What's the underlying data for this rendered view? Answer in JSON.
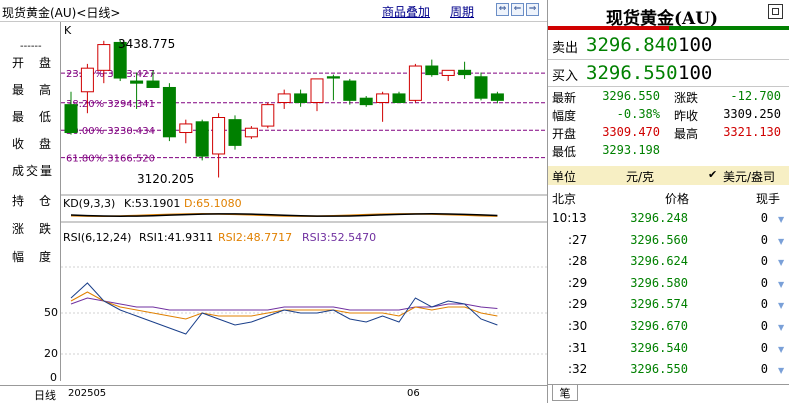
{
  "topbar": {
    "title": "现货黄金(AU)<日线>",
    "overlay_link": "商品叠加",
    "period_link": "周期",
    "nav_buttons": [
      "⇔",
      "⇐",
      "⇒",
      "▣"
    ]
  },
  "sidebar": {
    "dash": "------",
    "items": [
      "开盘",
      "最高",
      "最低",
      "收盘",
      "成交量",
      "持仓",
      "涨跌",
      "幅度"
    ]
  },
  "main_chart": {
    "label": "K",
    "high_label": "3438.775",
    "low_label": "3120.205",
    "fib_levels": [
      {
        "label": "23.60% 3363.427",
        "price": 3363.427
      },
      {
        "label": "38.20% 3294.341",
        "price": 3294.341
      },
      {
        "label": "50.00% 3230.434",
        "price": 3230.434
      },
      {
        "label": "61.80% 3166.520",
        "price": 3166.52
      }
    ],
    "candles": [
      {
        "o": 3290,
        "h": 3320,
        "l": 3220,
        "c": 3225
      },
      {
        "o": 3320,
        "h": 3385,
        "l": 3270,
        "c": 3375
      },
      {
        "o": 3370,
        "h": 3438.775,
        "l": 3340,
        "c": 3430
      },
      {
        "o": 3435,
        "h": 3440,
        "l": 3345,
        "c": 3352
      },
      {
        "o": 3345,
        "h": 3365,
        "l": 3280,
        "c": 3340
      },
      {
        "o": 3345,
        "h": 3370,
        "l": 3330,
        "c": 3330
      },
      {
        "o": 3330,
        "h": 3340,
        "l": 3205,
        "c": 3215
      },
      {
        "o": 3225,
        "h": 3255,
        "l": 3200,
        "c": 3245
      },
      {
        "o": 3250,
        "h": 3255,
        "l": 3160,
        "c": 3170
      },
      {
        "o": 3175,
        "h": 3270,
        "l": 3120.205,
        "c": 3260
      },
      {
        "o": 3255,
        "h": 3265,
        "l": 3185,
        "c": 3195
      },
      {
        "o": 3215,
        "h": 3240,
        "l": 3210,
        "c": 3235
      },
      {
        "o": 3240,
        "h": 3295,
        "l": 3235,
        "c": 3290
      },
      {
        "o": 3295,
        "h": 3325,
        "l": 3280,
        "c": 3315
      },
      {
        "o": 3315,
        "h": 3325,
        "l": 3285,
        "c": 3295
      },
      {
        "o": 3295,
        "h": 3350,
        "l": 3275,
        "c": 3350
      },
      {
        "o": 3355,
        "h": 3360,
        "l": 3300,
        "c": 3352
      },
      {
        "o": 3345,
        "h": 3350,
        "l": 3290,
        "c": 3300
      },
      {
        "o": 3305,
        "h": 3310,
        "l": 3285,
        "c": 3290
      },
      {
        "o": 3295,
        "h": 3320,
        "l": 3250,
        "c": 3315
      },
      {
        "o": 3315,
        "h": 3320,
        "l": 3295,
        "c": 3295
      },
      {
        "o": 3300,
        "h": 3385,
        "l": 3295,
        "c": 3380
      },
      {
        "o": 3380,
        "h": 3395,
        "l": 3355,
        "c": 3360
      },
      {
        "o": 3358,
        "h": 3365,
        "l": 3345,
        "c": 3370
      },
      {
        "o": 3370,
        "h": 3390,
        "l": 3350,
        "c": 3360
      },
      {
        "o": 3355,
        "h": 3365,
        "l": 3300,
        "c": 3305
      },
      {
        "o": 3315,
        "h": 3320,
        "l": 3293.198,
        "c": 3300
      }
    ]
  },
  "kd": {
    "label": "KD(9,3,3)",
    "k_label": "K:53.1901",
    "d_label": "D:65.1080",
    "k_color": "#000000",
    "d_color": "#e08000"
  },
  "rsi": {
    "label": "RSI(6,12,24)",
    "rsi1_label": "RSI1:41.9311",
    "rsi2_label": "RSI2:48.7717",
    "rsi3_label": "RSI3:52.5470",
    "rsi1_color": "#1a3f8a",
    "rsi2_color": "#e08000",
    "rsi3_color": "#7030a0",
    "axis_labels": [
      "50",
      "20",
      "0"
    ],
    "rsi1": [
      60,
      70,
      58,
      52,
      48,
      44,
      40,
      36,
      50,
      46,
      42,
      44,
      48,
      52,
      50,
      50,
      52,
      46,
      44,
      48,
      44,
      60,
      54,
      58,
      56,
      46,
      42
    ],
    "rsi2": [
      58,
      64,
      58,
      54,
      52,
      50,
      48,
      46,
      50,
      48,
      48,
      48,
      50,
      52,
      52,
      52,
      52,
      50,
      50,
      50,
      48,
      54,
      52,
      54,
      54,
      50,
      48
    ],
    "rsi3": [
      56,
      60,
      58,
      56,
      54,
      54,
      52,
      52,
      52,
      52,
      52,
      52,
      52,
      54,
      54,
      54,
      54,
      52,
      52,
      52,
      52,
      54,
      54,
      56,
      56,
      54,
      53
    ]
  },
  "bottom": {
    "left_label": "日线",
    "date_start": "202505",
    "date_mid": "06"
  },
  "right_panel": {
    "title": "现货黄金(AU)",
    "sell_label": "卖出",
    "sell_price": "3296.840",
    "sell_qty": "100",
    "buy_label": "买入",
    "buy_price": "3296.550",
    "buy_qty": "100",
    "stats": {
      "latest_label": "最新",
      "latest": "3296.550",
      "change_label": "涨跌",
      "change": "-12.700",
      "pct_label": "幅度",
      "pct": "-0.38%",
      "prev_label": "昨收",
      "prev": "3309.250",
      "open_label": "开盘",
      "open": "3309.470",
      "high_label": "最高",
      "high": "3321.130",
      "low_label": "最低",
      "low": "3293.198"
    },
    "unit_row": {
      "unit_label": "单位",
      "unit": "元/克",
      "alt_unit": "美元/盎司"
    },
    "tick_header": {
      "place": "北京",
      "price": "价格",
      "qty": "现手"
    },
    "ticks": [
      {
        "time": "10:13",
        "price": "3296.248",
        "qty": "0"
      },
      {
        "time": ":27",
        "price": "3296.560",
        "qty": "0"
      },
      {
        "time": ":28",
        "price": "3296.624",
        "qty": "0"
      },
      {
        "time": ":29",
        "price": "3296.580",
        "qty": "0"
      },
      {
        "time": ":29",
        "price": "3296.574",
        "qty": "0"
      },
      {
        "time": ":30",
        "price": "3296.670",
        "qty": "0"
      },
      {
        "time": ":31",
        "price": "3296.540",
        "qty": "0"
      },
      {
        "time": ":32",
        "price": "3296.550",
        "qty": "0"
      }
    ],
    "bottom_tab": "笔"
  }
}
